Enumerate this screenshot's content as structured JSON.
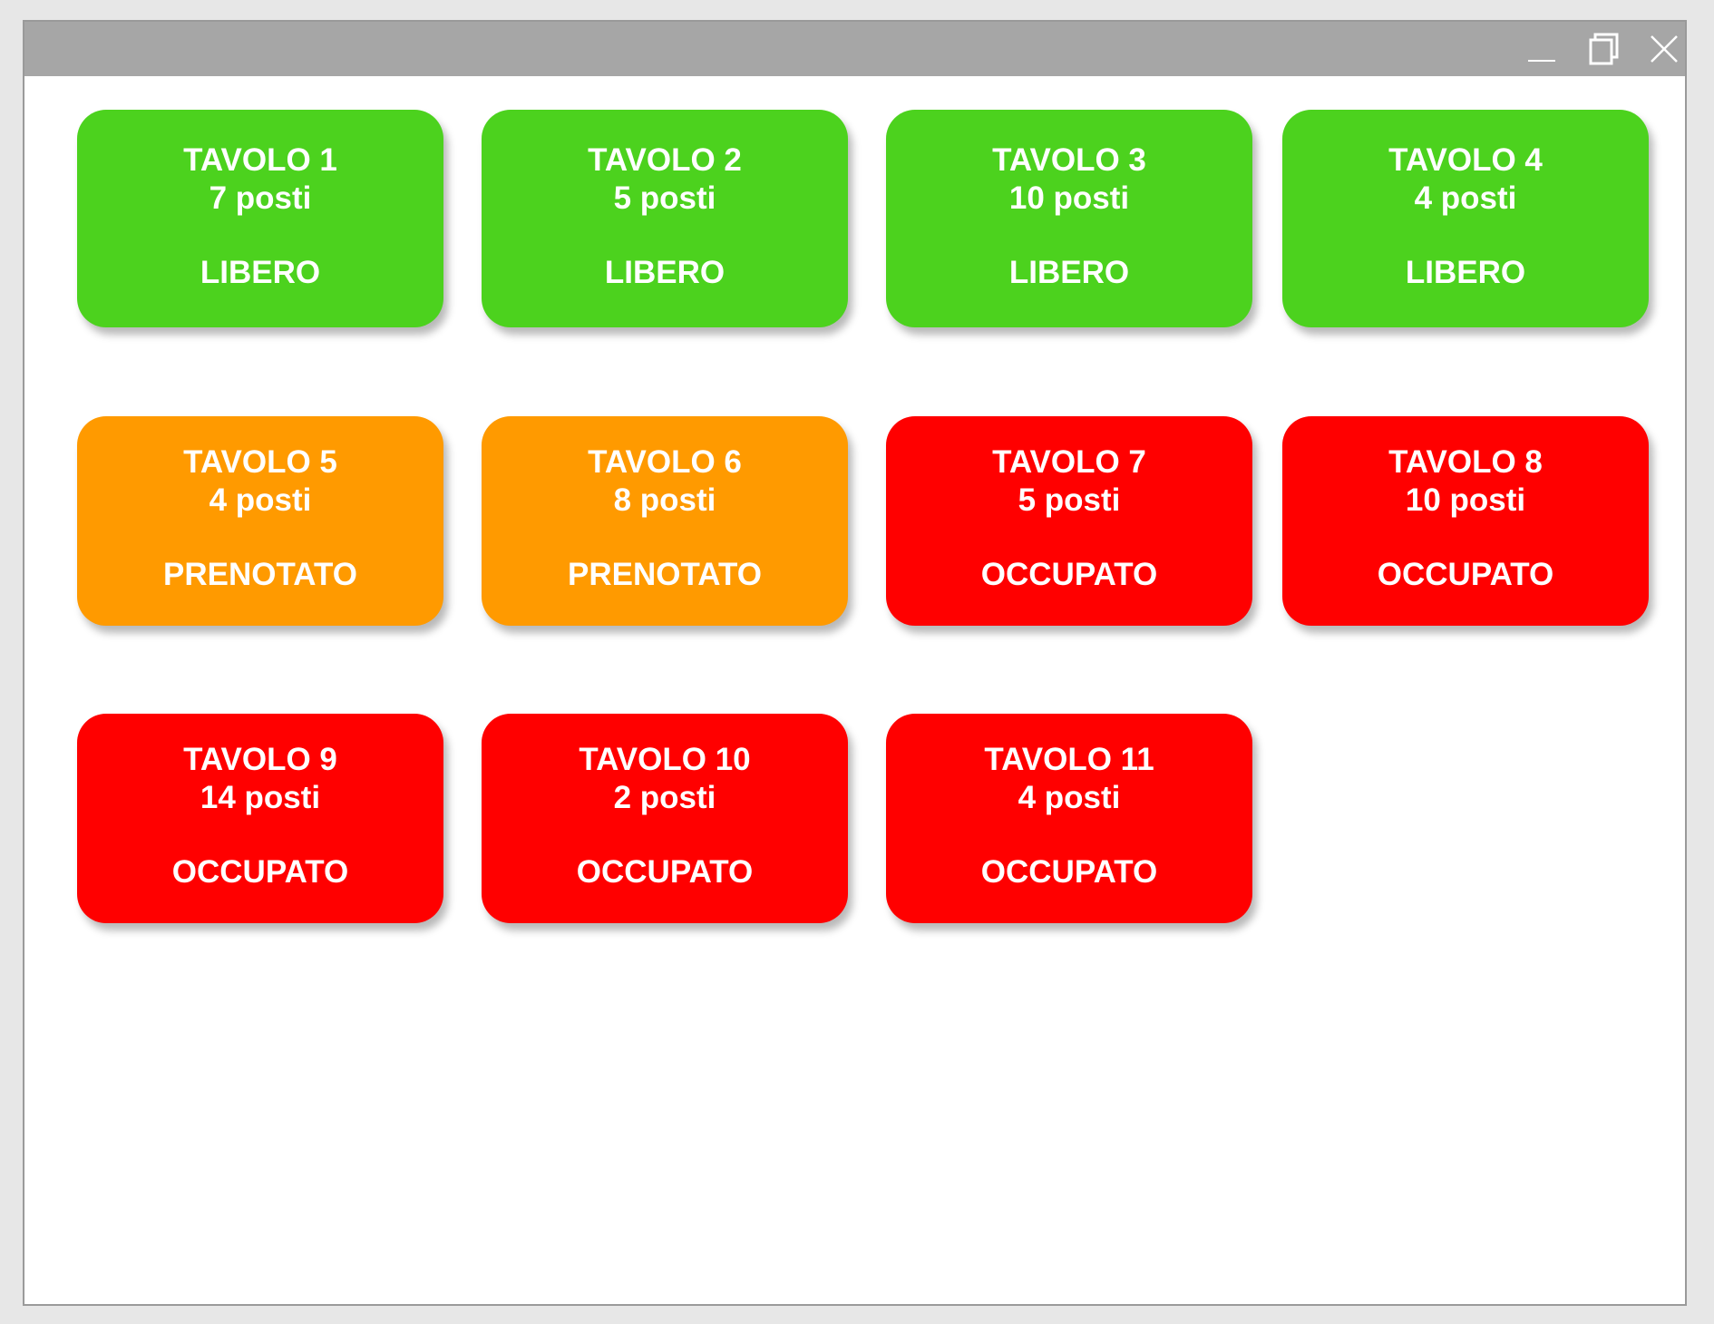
{
  "window": {
    "controls": {
      "minimize_icon": "minimize-icon",
      "maximize_icon": "maximize-icon",
      "close_icon": "close-icon"
    }
  },
  "colors": {
    "libero": "#4cd21e",
    "prenotato": "#ff9a00",
    "occupato": "#ff0000"
  },
  "tables": [
    {
      "name": "TAVOLO 1",
      "seats": "7 posti",
      "status": "LIBERO"
    },
    {
      "name": "TAVOLO 2",
      "seats": "5 posti",
      "status": "LIBERO"
    },
    {
      "name": "TAVOLO 3",
      "seats": "10 posti",
      "status": "LIBERO"
    },
    {
      "name": "TAVOLO 4",
      "seats": "4 posti",
      "status": "LIBERO"
    },
    {
      "name": "TAVOLO 5",
      "seats": "4 posti",
      "status": "PRENOTATO"
    },
    {
      "name": "TAVOLO 6",
      "seats": "8 posti",
      "status": "PRENOTATO"
    },
    {
      "name": "TAVOLO 7",
      "seats": "5 posti",
      "status": "OCCUPATO"
    },
    {
      "name": "TAVOLO 8",
      "seats": "10 posti",
      "status": "OCCUPATO"
    },
    {
      "name": "TAVOLO 9",
      "seats": "14 posti",
      "status": "OCCUPATO"
    },
    {
      "name": "TAVOLO 10",
      "seats": "2 posti",
      "status": "OCCUPATO"
    },
    {
      "name": "TAVOLO 11",
      "seats": "4 posti",
      "status": "OCCUPATO"
    }
  ]
}
